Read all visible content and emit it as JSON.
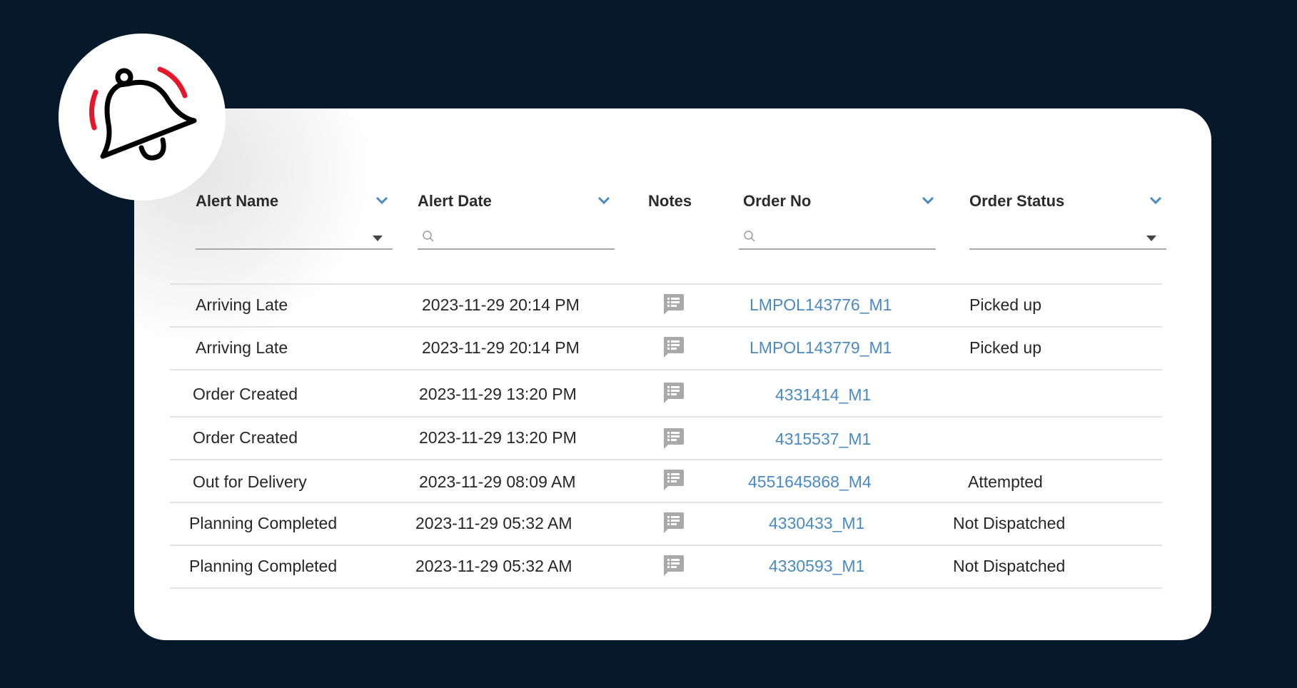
{
  "colors": {
    "background": "#05192b",
    "card": "#ffffff",
    "accent_link": "#4a8ac4",
    "chevron": "#4a8ac4",
    "bell_stroke": "#000000",
    "bell_ring": "#e5182b",
    "notes_icon": "#a9a9a9"
  },
  "badge": {
    "icon": "ringing-bell-icon"
  },
  "table": {
    "columns": [
      {
        "key": "alert_name",
        "title": "Alert Name",
        "sortable": true,
        "filter": "dropdown",
        "filter_value": ""
      },
      {
        "key": "alert_date",
        "title": "Alert Date",
        "sortable": true,
        "filter": "search",
        "filter_value": ""
      },
      {
        "key": "notes",
        "title": "Notes",
        "sortable": false,
        "filter": "none"
      },
      {
        "key": "order_no",
        "title": "Order No",
        "sortable": true,
        "filter": "search",
        "filter_value": ""
      },
      {
        "key": "order_status",
        "title": "Order Status",
        "sortable": true,
        "filter": "dropdown",
        "filter_value": ""
      }
    ],
    "rows": [
      {
        "alert_name": "Arriving Late",
        "alert_date": "2023-11-29 20:14 PM",
        "notes_icon": "notes-list-icon",
        "order_no": "LMPOL143776_M1",
        "order_status": "Picked up"
      },
      {
        "alert_name": "Arriving Late",
        "alert_date": "2023-11-29 20:14 PM",
        "notes_icon": "notes-list-icon",
        "order_no": "LMPOL143779_M1",
        "order_status": "Picked up"
      },
      {
        "alert_name": "Order Created",
        "alert_date": "2023-11-29 13:20 PM",
        "notes_icon": "notes-list-icon",
        "order_no": "4331414_M1",
        "order_status": ""
      },
      {
        "alert_name": "Order Created",
        "alert_date": "2023-11-29 13:20 PM",
        "notes_icon": "notes-list-icon",
        "order_no": "4315537_M1",
        "order_status": ""
      },
      {
        "alert_name": "Out for Delivery",
        "alert_date": "2023-11-29 08:09 AM",
        "notes_icon": "notes-list-icon",
        "order_no": "4551645868_M4",
        "order_status": "Attempted"
      },
      {
        "alert_name": "Planning Completed",
        "alert_date": "2023-11-29 05:32 AM",
        "notes_icon": "notes-list-icon",
        "order_no": "4330433_M1",
        "order_status": "Not Dispatched"
      },
      {
        "alert_name": "Planning Completed",
        "alert_date": "2023-11-29 05:32 AM",
        "notes_icon": "notes-list-icon",
        "order_no": "4330593_M1",
        "order_status": "Not Dispatched"
      }
    ]
  }
}
